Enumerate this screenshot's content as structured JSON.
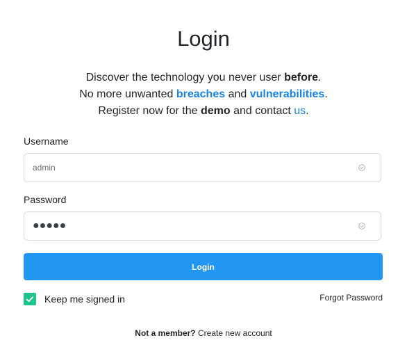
{
  "title": "Login",
  "intro": {
    "line1_text": "Discover the technology you never user ",
    "line1_bold": "before",
    "line1_end": ".",
    "line2_text": "No more unwanted ",
    "line2_link1": "breaches",
    "line2_and": " and ",
    "line2_link2": "vulnerabilities",
    "line2_end": ".",
    "line3_text": "Register now for the ",
    "line3_bold": "demo",
    "line3_mid": " and contact ",
    "line3_link": "us",
    "line3_end": "."
  },
  "form": {
    "username_label": "Username",
    "username_value": "admin",
    "password_label": "Password",
    "password_display": "●●●●●",
    "login_label": "Login",
    "keep_signed_in_label": "Keep me signed in",
    "keep_signed_in_checked": true,
    "forgot_password_label": "Forgot Password"
  },
  "footer": {
    "not_member": "Not a member?",
    "create_account": "Create new account"
  },
  "colors": {
    "accent": "#2196f3",
    "link": "#1a83e6",
    "checkbox": "#1fc48c"
  },
  "icons": {
    "field_status": "check-circle-icon",
    "checkbox": "checkmark-icon"
  }
}
